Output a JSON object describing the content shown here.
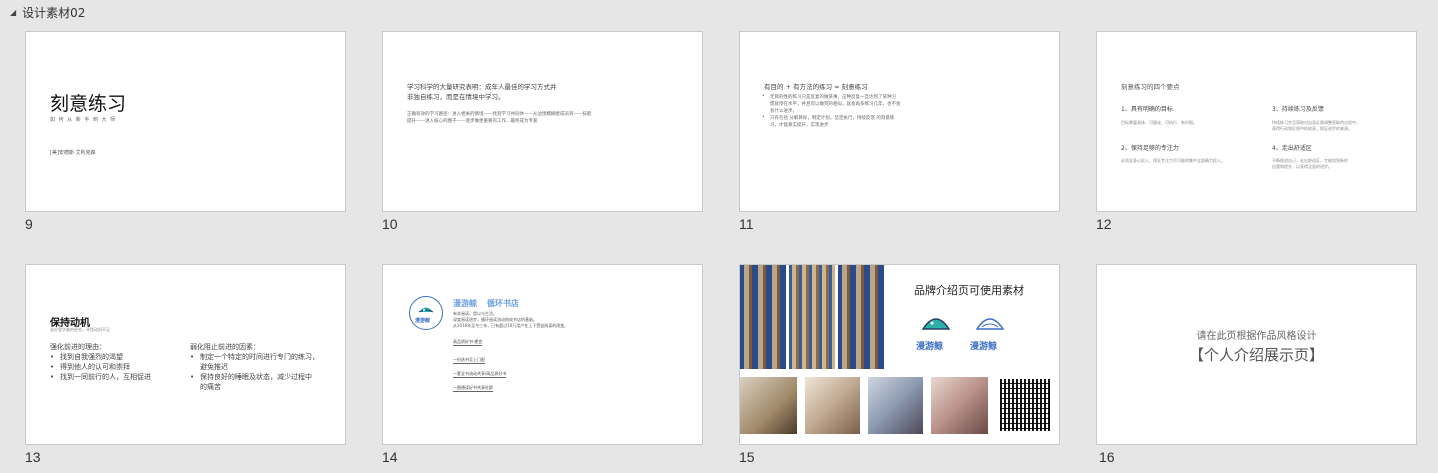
{
  "section": {
    "title": "设计素材02"
  },
  "slides": [
    {
      "number": "9",
      "title": "刻意练习",
      "subtitle": "如 何 从 新 手 到 大 师",
      "author": "[美]安德斯·艾利克森"
    },
    {
      "number": "10",
      "line1": "学习科学的大量研究表明：成年人最佳的学习方式并",
      "line2": "非独自练习，而是在情境中学习。",
      "body1": "正确有效的学习路径：进入相关的情境——找到学习共同体——从边围模糊者成员到——技能",
      "body2": "提升——进入核心的圈子——逐步做更重要的工作，最终成为专家"
    },
    {
      "number": "11",
      "heading": "有目的 + 有方法的练习 = 刻意练习",
      "bullets": [
        "无目的性的练习只是反复的做某事，这种反复一旦达到了某种习",
        "惯就停在水平，并且可以做到的相似，就会再多练习几年，也不会",
        "有什么进步。",
        "只有包括 分解目标，制定计划，坚定执行，持续反馈 的刻意练",
        "习，才能真实提升，实现进步"
      ]
    },
    {
      "number": "12",
      "heading": "刻意练习的四个要点",
      "p1_title": "1、具有明确的目标",
      "p1_body": "目标需要具体、可量化、可执行、有时限。",
      "p2_title": "2、保持足够的专注力",
      "p2_body": "必须全身心投入，保证专注力尽可能的集中全部精力投入。",
      "p3_title": "3、持续练习及反馈",
      "p3_body1": "持续练习并且获取对自身反馈调整获取的过程中，",
      "p3_body2": "获得行动和反馈中的收获，保证进步的来源。",
      "p4_title": "4、走出舒适区",
      "p4_body1": "不断挑战自己，走出舒适区，才能找到新的",
      "p4_body2": "自我和提升，以获得全面的进步。"
    },
    {
      "number": "13",
      "title": "保持动机",
      "subtitle": "走好登学者的经验，寻找动机不足",
      "left_heading": "强化前进的理由：",
      "left_items": [
        "找到自我强烈的渴望",
        "得到他人的认可和崇拜",
        "找到一同前行的人，互相促进"
      ],
      "right_heading": "弱化阻止前进的因素：",
      "right_items": [
        "制定一个特定的时间进行专门的练习，",
        "避免推迟",
        "保持良好的睡眠及状态，减少过程中",
        "的痛苦"
      ]
    },
    {
      "number": "14",
      "brand": "漫游鲸",
      "store": "循环书店",
      "logo_text": "漫游鲸",
      "intro1": "有关阅读，是以与生活。",
      "intro2": "深度阅读进步，循环阅读流动构成书店的基础。",
      "intro3": "从2016年至今三年，已有超过10万用户在上下受益阅读的改变。",
      "items": [
        "高品质好书·便宜",
        "一份选书至上门配",
        "一套全书流动共享/高品质好书",
        "一图想读好书共享社群",
        "一一精心分享全好书店"
      ]
    },
    {
      "number": "15",
      "title": "品牌介绍页可使用素材",
      "logo1": "漫游鲸",
      "logo2": "漫游鲸"
    },
    {
      "number": "16",
      "line1": "请在此页根据作品风格设计",
      "line2": "【个人介绍展示页】"
    }
  ],
  "colors": {
    "brand_blue": "#3a6ec8",
    "brand_teal": "#2ab1a8",
    "page_bg": "#e6e6e6"
  }
}
